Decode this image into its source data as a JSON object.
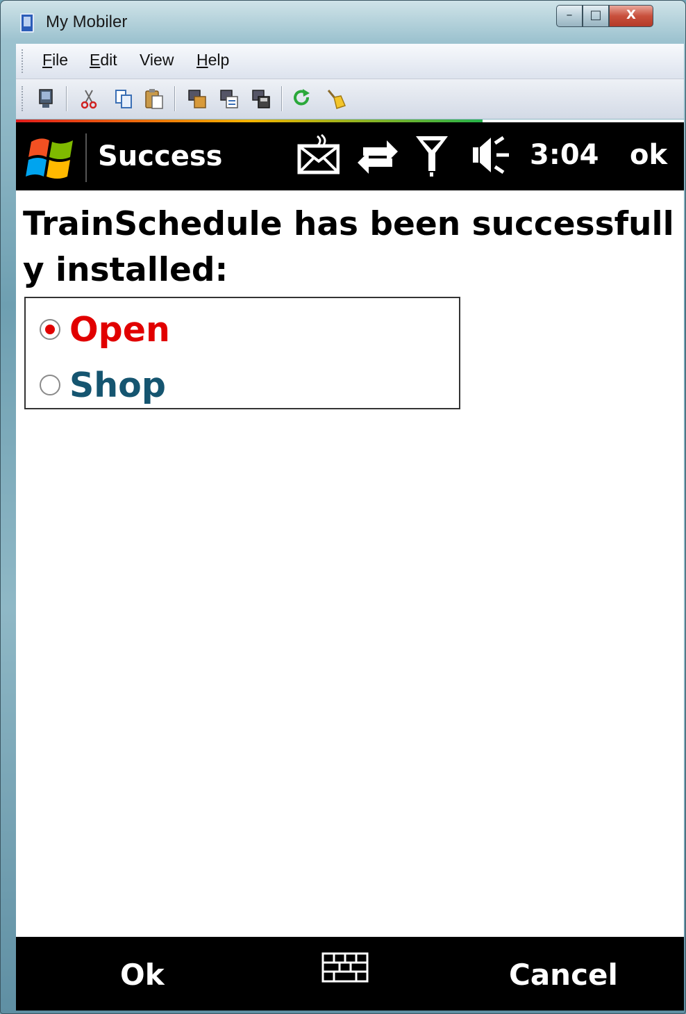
{
  "window": {
    "title": "My Mobiler",
    "controls": {
      "minimize": "–",
      "maximize": "□",
      "close": "X"
    }
  },
  "menu": {
    "items": [
      {
        "accel": "F",
        "rest": "ile"
      },
      {
        "accel": "E",
        "rest": "dit"
      },
      {
        "accel": "",
        "rest": "View"
      },
      {
        "accel": "H",
        "rest": "elp"
      }
    ]
  },
  "toolbar": {
    "icons": [
      "device-icon",
      "cut-icon",
      "copy-icon",
      "paste-icon",
      "screen-copy-icon",
      "screen-paste-icon",
      "screen-save-icon",
      "refresh-icon",
      "clear-icon"
    ]
  },
  "phone": {
    "status": {
      "title": "Success",
      "time": "3:04",
      "ok": "ok",
      "icons": [
        "notification-icon",
        "sync-icon",
        "signal-icon",
        "volume-icon"
      ]
    },
    "message": "TrainSchedule has been successfully installed:",
    "options": [
      {
        "label": "Open",
        "selected": true,
        "color": "#e10000"
      },
      {
        "label": "Shop",
        "selected": false,
        "color": "#155570"
      }
    ],
    "softkeys": {
      "left": "Ok",
      "right": "Cancel"
    }
  }
}
